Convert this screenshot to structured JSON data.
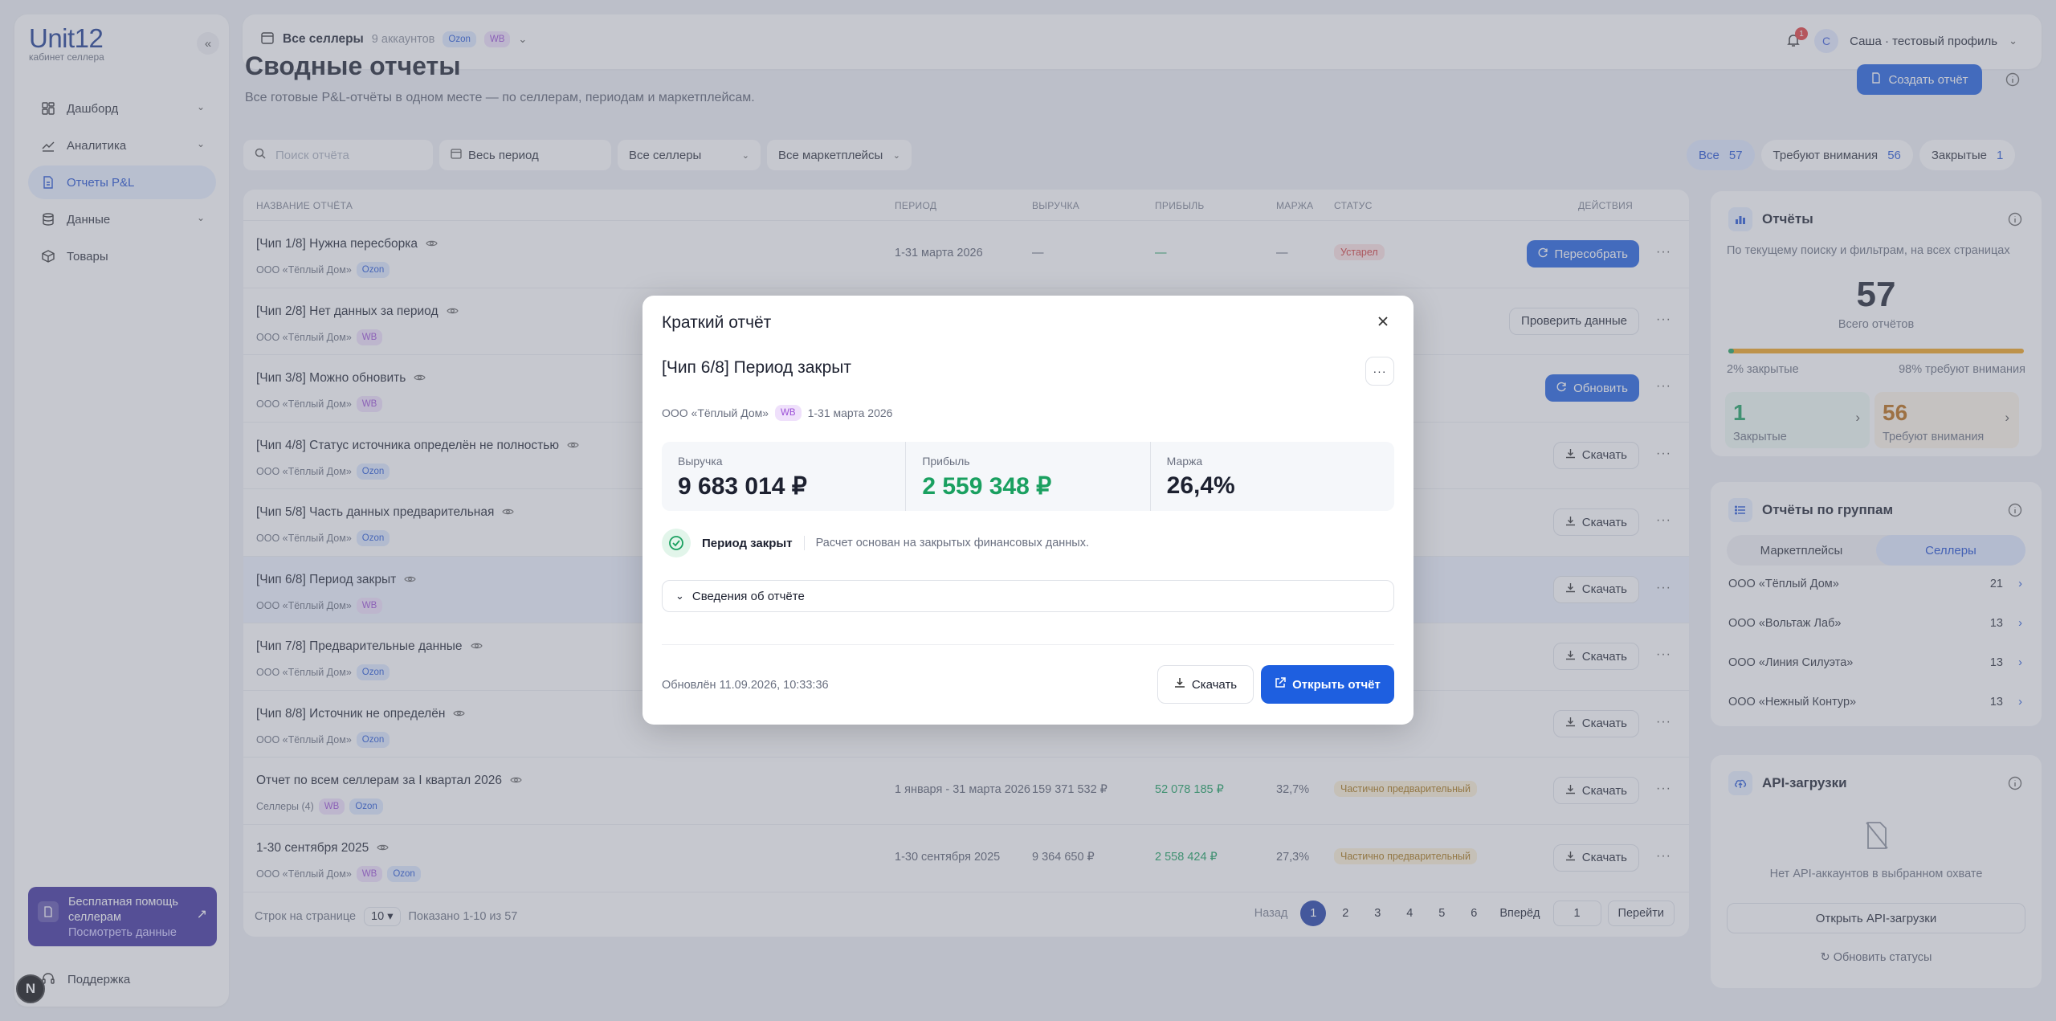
{
  "sidebar": {
    "logo_main": "Unit12",
    "logo_sub": "кабинет селлера",
    "collapse_glyph": "«",
    "items": [
      {
        "label": "Дашборд",
        "icon": "dashboard-icon",
        "has_chevron": true
      },
      {
        "label": "Аналитика",
        "icon": "chart-icon",
        "has_chevron": true
      },
      {
        "label": "Отчеты P&L",
        "icon": "report-icon",
        "active": true
      },
      {
        "label": "Данные",
        "icon": "database-icon",
        "has_chevron": true
      },
      {
        "label": "Товары",
        "icon": "box-icon"
      }
    ],
    "promo": {
      "line1": "Бесплатная помощь селлерам",
      "line2": "Посмотреть данные"
    },
    "support": "Поддержка",
    "n_badge": "N"
  },
  "topbar": {
    "title": "Все селлеры",
    "count": "9 аккаунтов",
    "chip_ozon": "Ozon",
    "chip_wb": "WB",
    "notif_count": "1",
    "avatar_letter": "С",
    "user_name": "Саша · тестовый профиль"
  },
  "page": {
    "title": "Сводные отчеты",
    "subtitle": "Все готовые P&L-отчёты в одном месте — по селлерам, периодам и маркетплейсам.",
    "create_button": "Создать отчёт"
  },
  "filters": {
    "search_placeholder": "Поиск отчёта",
    "period": "Весь период",
    "sellers": "Все селлеры",
    "marketplaces": "Все маркетплейсы"
  },
  "segments": [
    {
      "label": "Все",
      "count": "57",
      "active": true
    },
    {
      "label": "Требуют внимания",
      "count": "56"
    },
    {
      "label": "Закрытые",
      "count": "1"
    }
  ],
  "table": {
    "headers": {
      "name": "Название отчёта",
      "period": "Период",
      "revenue": "Выручка",
      "profit": "Прибыль",
      "margin": "Маржа",
      "status": "Статус",
      "actions": "Действия"
    },
    "rows": [
      {
        "name": "[Чип 1/8] Нужна пересборка",
        "org": "ООО «Тёплый Дом»",
        "chips": [
          "Ozon"
        ],
        "period": "1-31 марта 2026",
        "revenue": "—",
        "profit": "—",
        "margin": "—",
        "status": "Устарел",
        "status_kind": "red",
        "action": "Пересобрать",
        "action_kind": "blue"
      },
      {
        "name": "[Чип 2/8] Нет данных за период",
        "org": "ООО «Тёплый Дом»",
        "chips": [
          "WB"
        ],
        "period": "",
        "revenue": "",
        "profit": "",
        "margin": "",
        "status": "",
        "status_kind": "",
        "action": "Проверить данные",
        "action_kind": "white"
      },
      {
        "name": "[Чип 3/8] Можно обновить",
        "org": "ООО «Тёплый Дом»",
        "chips": [
          "WB"
        ],
        "period": "",
        "revenue": "",
        "profit": "",
        "margin": "",
        "status": "",
        "status_kind": "",
        "action": "Обновить",
        "action_kind": "blue"
      },
      {
        "name": "[Чип 4/8] Статус источника определён не полностью",
        "org": "ООО «Тёплый Дом»",
        "chips": [
          "Ozon"
        ],
        "period": "",
        "revenue": "",
        "profit": "",
        "margin": "",
        "status": "",
        "status_kind": "",
        "action": "Скачать",
        "action_kind": "white"
      },
      {
        "name": "[Чип 5/8] Часть данных предварительная",
        "org": "ООО «Тёплый Дом»",
        "chips": [
          "Ozon"
        ],
        "period": "",
        "revenue": "",
        "profit": "",
        "margin": "",
        "status": "",
        "status_kind": "",
        "action": "Скачать",
        "action_kind": "white"
      },
      {
        "name": "[Чип 6/8] Период закрыт",
        "org": "ООО «Тёплый Дом»",
        "chips": [
          "WB"
        ],
        "period": "",
        "revenue": "",
        "profit": "",
        "margin": "",
        "status": "",
        "status_kind": "",
        "action": "Скачать",
        "action_kind": "white",
        "selected": true
      },
      {
        "name": "[Чип 7/8] Предварительные данные",
        "org": "ООО «Тёплый Дом»",
        "chips": [
          "Ozon"
        ],
        "period": "",
        "revenue": "",
        "profit": "",
        "margin": "",
        "status": "",
        "status_kind": "",
        "action": "Скачать",
        "action_kind": "white"
      },
      {
        "name": "[Чип 8/8] Источник не определён",
        "org": "ООО «Тёплый Дом»",
        "chips": [
          "Ozon"
        ],
        "period": "",
        "revenue": "",
        "profit": "",
        "margin": "",
        "status": "",
        "status_kind": "",
        "action": "Скачать",
        "action_kind": "white"
      },
      {
        "name": "Отчет по всем селлерам за I квартал 2026",
        "org": "Селлеры (4)",
        "chips": [
          "WB",
          "Ozon"
        ],
        "period": "1 января - 31 марта 2026",
        "revenue": "159 371 532 ₽",
        "profit": "52 078 185 ₽",
        "margin": "32,7%",
        "status": "Частично предварительный",
        "status_kind": "yel",
        "action": "Скачать",
        "action_kind": "white"
      },
      {
        "name": "1-30 сентября 2025",
        "org": "ООО «Тёплый Дом»",
        "chips": [
          "WB",
          "Ozon"
        ],
        "period": "1-30 сентября 2025",
        "revenue": "9 364 650 ₽",
        "profit": "2 558 424 ₽",
        "margin": "27,3%",
        "status": "Частично предварительный",
        "status_kind": "yel",
        "action": "Скачать",
        "action_kind": "white"
      }
    ],
    "footer": {
      "rows_label": "Строк на странице",
      "rows_value": "10",
      "shown": "Показано 1-10 из 57",
      "prev": "Назад",
      "pages": [
        "1",
        "2",
        "3",
        "4",
        "5",
        "6"
      ],
      "next": "Вперёд",
      "goto_value": "1",
      "goto_button": "Перейти"
    }
  },
  "reports_card": {
    "title": "Отчёты",
    "subtitle": "По текущему поиску и фильтрам, на всех страницах",
    "total": "57",
    "total_label": "Всего отчётов",
    "closed_share": 0.02,
    "left_label": "2% закрытые",
    "right_label": "98% требуют внимания",
    "closed_value": "1",
    "closed_label": "Закрытые",
    "attention_value": "56",
    "attention_label": "Требуют внимания"
  },
  "groups_card": {
    "title": "Отчёты по группам",
    "tabs": [
      "Маркетплейсы",
      "Селлеры"
    ],
    "active_tab": 1,
    "items": [
      {
        "name": "ООО «Тёплый Дом»",
        "count": "21"
      },
      {
        "name": "ООО «Вольтаж Лаб»",
        "count": "13"
      },
      {
        "name": "ООО «Линия Силуэта»",
        "count": "13"
      },
      {
        "name": "ООО «Нежный Контур»",
        "count": "13"
      }
    ]
  },
  "api_card": {
    "title": "API-загрузки",
    "empty": "Нет API-аккаунтов в выбранном охвате",
    "open_button": "Открыть API-загрузки",
    "refresh": "Обновить статусы"
  },
  "modal": {
    "title": "Краткий отчёт",
    "report_name": "[Чип 6/8] Период закрыт",
    "org": "ООО «Тёплый Дом»",
    "chip": "WB",
    "period": "1-31 марта 2026",
    "kpis": [
      {
        "label": "Выручка",
        "value": "9 683 014 ₽"
      },
      {
        "label": "Прибыль",
        "value": "2 559 348 ₽"
      },
      {
        "label": "Маржа",
        "value": "26,4%"
      }
    ],
    "status_title": "Период закрыт",
    "status_desc": "Расчет основан на закрытых финансовых данных.",
    "accordion": "Сведения об отчёте",
    "updated": "Обновлён 11.09.2026, 10:33:36",
    "download": "Скачать",
    "open": "Открыть отчёт"
  },
  "colors": {
    "accent": "#1e5fe0",
    "profit": "#1aa060",
    "warning": "#f0a21a",
    "danger": "#d23b3b"
  }
}
